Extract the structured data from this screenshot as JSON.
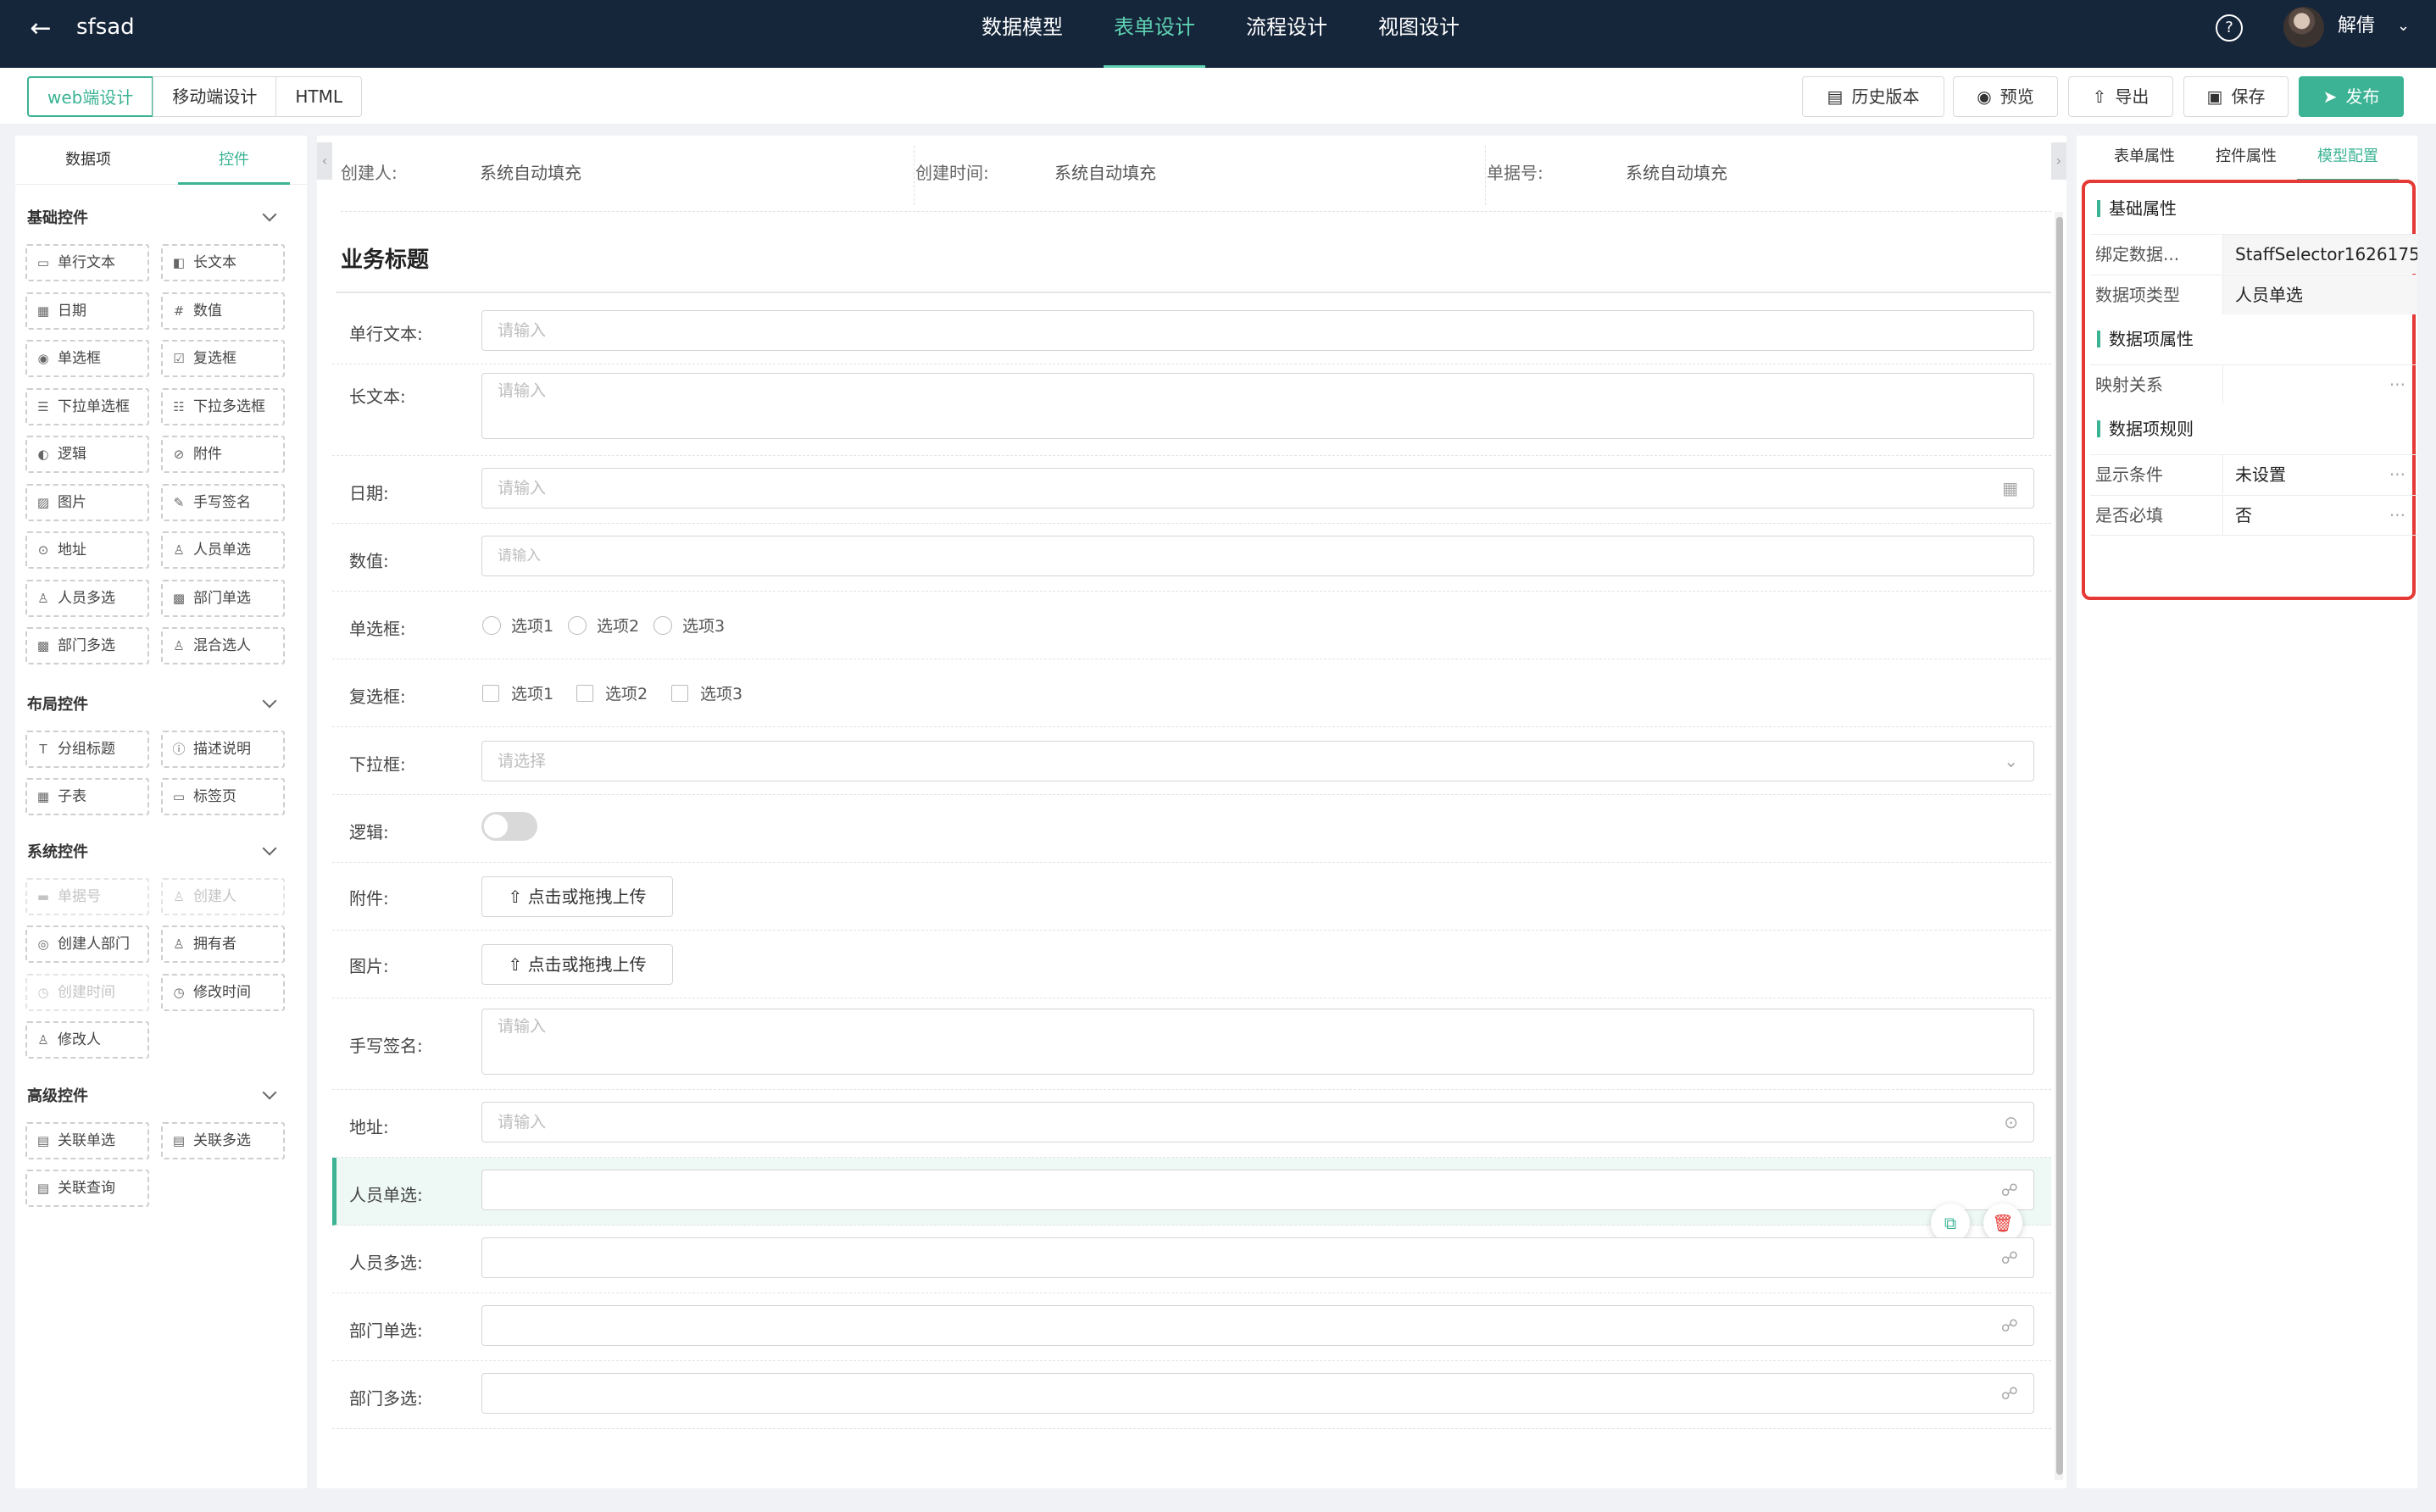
{
  "header": {
    "back_icon": "arrow-left-icon",
    "title": "sfsad",
    "nav": [
      {
        "label": "数据模型",
        "active": false
      },
      {
        "label": "表单设计",
        "active": true
      },
      {
        "label": "流程设计",
        "active": false
      },
      {
        "label": "视图设计",
        "active": false
      }
    ],
    "help_icon": "question-circle-icon",
    "user_name": "解倩"
  },
  "toolbar": {
    "modes": [
      {
        "label": "web端设计",
        "active": true
      },
      {
        "label": "移动端设计",
        "active": false
      },
      {
        "label": "HTML",
        "active": false
      }
    ],
    "history": "历史版本",
    "preview": "预览",
    "export": "导出",
    "save": "保存",
    "publish": "发布"
  },
  "left": {
    "tabs": [
      "数据项",
      "控件"
    ],
    "active_tab": "控件",
    "groups": [
      {
        "title": "基础控件",
        "items": [
          {
            "label": "单行文本",
            "icon": "input-icon"
          },
          {
            "label": "长文本",
            "icon": "textarea-icon"
          },
          {
            "label": "日期",
            "icon": "calendar-icon"
          },
          {
            "label": "数值",
            "icon": "number-icon"
          },
          {
            "label": "单选框",
            "icon": "radio-icon"
          },
          {
            "label": "复选框",
            "icon": "checkbox-icon"
          },
          {
            "label": "下拉单选框",
            "icon": "list-icon"
          },
          {
            "label": "下拉多选框",
            "icon": "list-check-icon"
          },
          {
            "label": "逻辑",
            "icon": "toggle-icon"
          },
          {
            "label": "附件",
            "icon": "paperclip-icon"
          },
          {
            "label": "图片",
            "icon": "image-icon"
          },
          {
            "label": "手写签名",
            "icon": "pen-icon"
          },
          {
            "label": "地址",
            "icon": "location-icon"
          },
          {
            "label": "人员单选",
            "icon": "user-icon"
          },
          {
            "label": "人员多选",
            "icon": "users-icon"
          },
          {
            "label": "部门单选",
            "icon": "department-icon"
          },
          {
            "label": "部门多选",
            "icon": "departments-icon"
          },
          {
            "label": "混合选人",
            "icon": "user-mixed-icon"
          }
        ]
      },
      {
        "title": "布局控件",
        "items": [
          {
            "label": "分组标题",
            "icon": "title-icon"
          },
          {
            "label": "描述说明",
            "icon": "info-icon"
          },
          {
            "label": "子表",
            "icon": "table-icon"
          },
          {
            "label": "标签页",
            "icon": "tabs-icon"
          }
        ]
      },
      {
        "title": "系统控件",
        "items": [
          {
            "label": "单据号",
            "icon": "serial-icon",
            "disabled": true
          },
          {
            "label": "创建人",
            "icon": "user-icon",
            "disabled": true
          },
          {
            "label": "创建人部门",
            "icon": "department-icon"
          },
          {
            "label": "拥有者",
            "icon": "user-icon"
          },
          {
            "label": "创建时间",
            "icon": "clock-icon",
            "disabled": true
          },
          {
            "label": "修改时间",
            "icon": "clock-edit-icon"
          },
          {
            "label": "修改人",
            "icon": "user-icon"
          }
        ]
      },
      {
        "title": "高级控件",
        "items": [
          {
            "label": "关联单选",
            "icon": "link-form-icon"
          },
          {
            "label": "关联多选",
            "icon": "link-form-icon"
          },
          {
            "label": "关联查询",
            "icon": "link-search-icon"
          }
        ]
      }
    ]
  },
  "form": {
    "system": [
      {
        "label": "创建人:",
        "value": "系统自动填充"
      },
      {
        "label": "创建时间:",
        "value": "系统自动填充"
      },
      {
        "label": "单据号:",
        "value": "系统自动填充"
      }
    ],
    "title": "业务标题",
    "fields": {
      "single_text": {
        "label": "单行文本:",
        "placeholder": "请输入"
      },
      "long_text": {
        "label": "长文本:",
        "placeholder": "请输入"
      },
      "date": {
        "label": "日期:",
        "placeholder": "请输入"
      },
      "number": {
        "label": "数值:",
        "placeholder": "请输入"
      },
      "radio": {
        "label": "单选框:",
        "options": [
          "选项1",
          "选项2",
          "选项3"
        ]
      },
      "checkbox": {
        "label": "复选框:",
        "options": [
          "选项1",
          "选项2",
          "选项3"
        ]
      },
      "dropdown": {
        "label": "下拉框:",
        "placeholder": "请选择"
      },
      "logic": {
        "label": "逻辑:",
        "on": false
      },
      "attachment": {
        "label": "附件:",
        "button": "点击或拖拽上传"
      },
      "image": {
        "label": "图片:",
        "button": "点击或拖拽上传"
      },
      "signature": {
        "label": "手写签名:",
        "placeholder": "请输入"
      },
      "address": {
        "label": "地址:",
        "placeholder": "请输入"
      },
      "user_single": {
        "label": "人员单选:",
        "selected": true
      },
      "user_multi": {
        "label": "人员多选:"
      },
      "dept_single": {
        "label": "部门单选:"
      },
      "dept_multi": {
        "label": "部门多选:"
      }
    }
  },
  "right": {
    "tabs": [
      "表单属性",
      "控件属性",
      "模型配置"
    ],
    "active_tab": "模型配置",
    "sections": [
      {
        "title": "基础属性",
        "rows": [
          {
            "key": "绑定数据...",
            "value": "StaffSelector1626175..."
          },
          {
            "key": "数据项类型",
            "value": "人员单选"
          }
        ]
      },
      {
        "title": "数据项属性",
        "rows": [
          {
            "key": "映射关系",
            "value": ""
          }
        ]
      },
      {
        "title": "数据项规则",
        "rows": [
          {
            "key": "显示条件",
            "value": "未设置"
          },
          {
            "key": "是否必填",
            "value": "否"
          }
        ]
      }
    ],
    "more": "···"
  },
  "colors": {
    "topbar": "#15253a",
    "accent": "#3bb394",
    "highlight_box": "#e53935"
  }
}
